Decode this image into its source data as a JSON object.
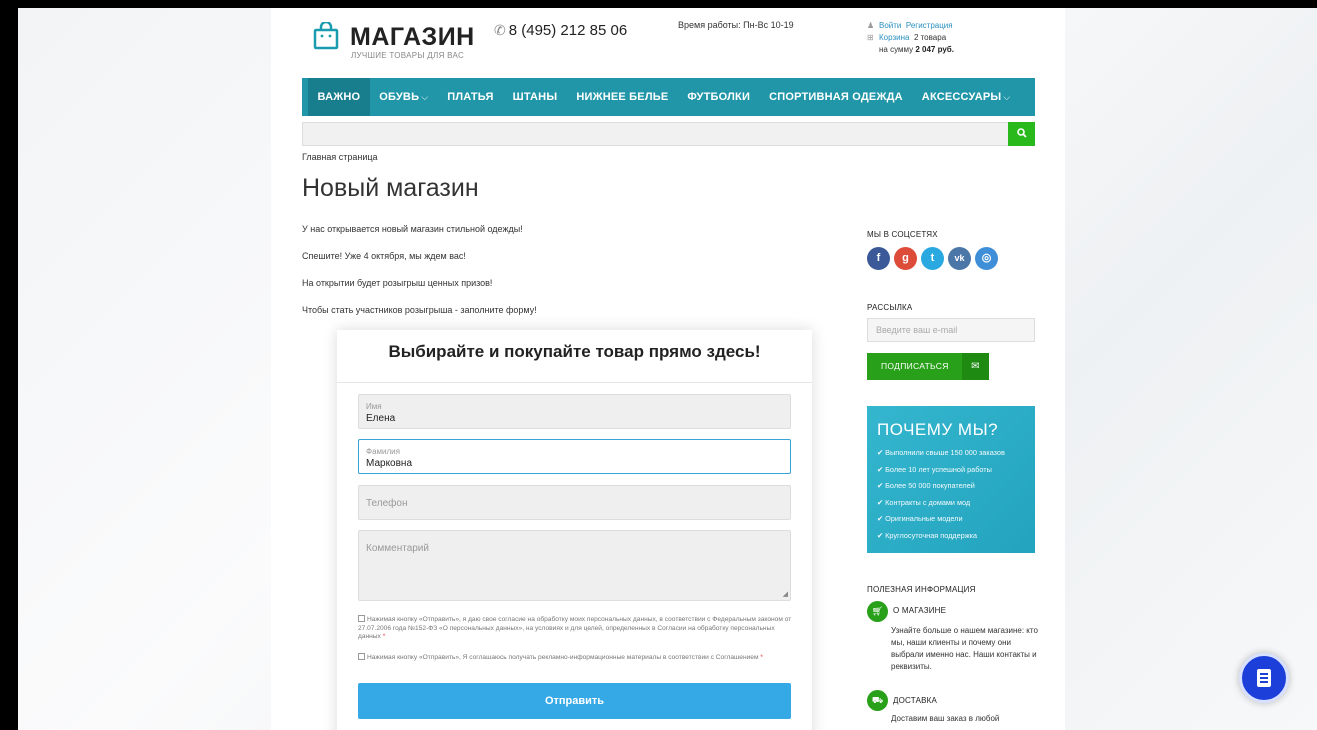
{
  "header": {
    "logo_title": "МАГАЗИН",
    "logo_subtitle": "ЛУЧШИЕ ТОВАРЫ ДЛЯ ВАС",
    "phone": "8 (495) 212 85 06",
    "hours": "Время работы: Пн-Вс 10-19",
    "login": "Войти",
    "register": "Регистрация",
    "cart_link": "Корзина",
    "cart_count": "2 товара",
    "cart_sum_prefix": "на сумму",
    "cart_sum": "2 047 руб."
  },
  "nav": {
    "items": [
      {
        "label": "ВАЖНО",
        "chevron": ""
      },
      {
        "label": "ОБУВЬ",
        "chevron": "⌵"
      },
      {
        "label": "ПЛАТЬЯ",
        "chevron": ""
      },
      {
        "label": "ШТАНЫ",
        "chevron": ""
      },
      {
        "label": "НИЖНЕЕ БЕЛЬЕ",
        "chevron": ""
      },
      {
        "label": "ФУТБОЛКИ",
        "chevron": ""
      },
      {
        "label": "СПОРТИВНАЯ ОДЕЖДА",
        "chevron": ""
      },
      {
        "label": "АКСЕССУАРЫ",
        "chevron": "⌵"
      }
    ]
  },
  "search": {
    "value": "",
    "icon": "search-icon"
  },
  "breadcrumb": "Главная страница",
  "page_title": "Новый магазин",
  "paragraphs": [
    "У нас открывается новый магазин стильной одежды!",
    "Спешите! Уже 4 октября, мы ждем вас!",
    "На открытии будет розыгрыш ценных призов!",
    "Чтобы стать участников розыгрыша - заполните форму!"
  ],
  "form": {
    "title": "Выбирайте и покупайте товар прямо здесь!",
    "name_label": "Имя",
    "name_value": "Елена",
    "surname_label": "Фамилия",
    "surname_value": "Марковна",
    "phone_placeholder": "Телефон",
    "comment_placeholder": "Комментарий",
    "consent1": "Нажимая кнопку «Отправить», я даю свое согласие на обработку моих персональных данных, в соответствии с Федеральным законом от 27.07.2006 года №152-ФЗ «О персональных данных», на условиях и для целей, определенных в Согласии на обработку персональных данных",
    "consent2": "Нажимая кнопку «Отправить», Я соглашаюсь получать рекламно-информационные материалы в соответствии с Соглашением",
    "required_mark": "*",
    "submit": "Отправить"
  },
  "sidebar": {
    "social_title": "МЫ В СОЦСЕТЯХ",
    "social": [
      {
        "name": "facebook-icon",
        "glyph": "f",
        "color": "#3b5998"
      },
      {
        "name": "google-plus-icon",
        "glyph": "g",
        "color": "#dd4b39"
      },
      {
        "name": "twitter-icon",
        "glyph": "t",
        "color": "#2aa9e0"
      },
      {
        "name": "vk-icon",
        "glyph": "vk",
        "color": "#4a76a8"
      },
      {
        "name": "instagram-icon",
        "glyph": "◎",
        "color": "#3f8ed8"
      }
    ],
    "newsletter_title": "РАССЫЛКА",
    "email_placeholder": "Введите ваш e-mail",
    "subscribe": "ПОДПИСАТЬСЯ",
    "why_title": "ПОЧЕМУ МЫ?",
    "why_items": [
      "✔ Выполнили свыше 150 000 заказов",
      "✔ Более 10 лет успешной работы",
      "✔ Более 50 000 покупателей",
      "✔ Контракты с домами мод",
      "✔ Оригинальные модели",
      "✔ Круглосуточная поддержка"
    ],
    "useful_title": "ПОЛЕЗНАЯ ИНФОРМАЦИЯ",
    "about_title": "О МАГАЗИНЕ",
    "about_text": "Узнайте больше о нашем магазине: кто мы, наши клиенты и почему они выбрали именно нас. Наши контакты и реквизиты.",
    "delivery_title": "ДОСТАВКА",
    "delivery_text": "Доставим ваш заказ в любой"
  },
  "colors": {
    "nav": "#2196a8",
    "accent_green": "#28a019",
    "submit_blue": "#35a8e6",
    "chat_fab": "#1b3fd8"
  }
}
